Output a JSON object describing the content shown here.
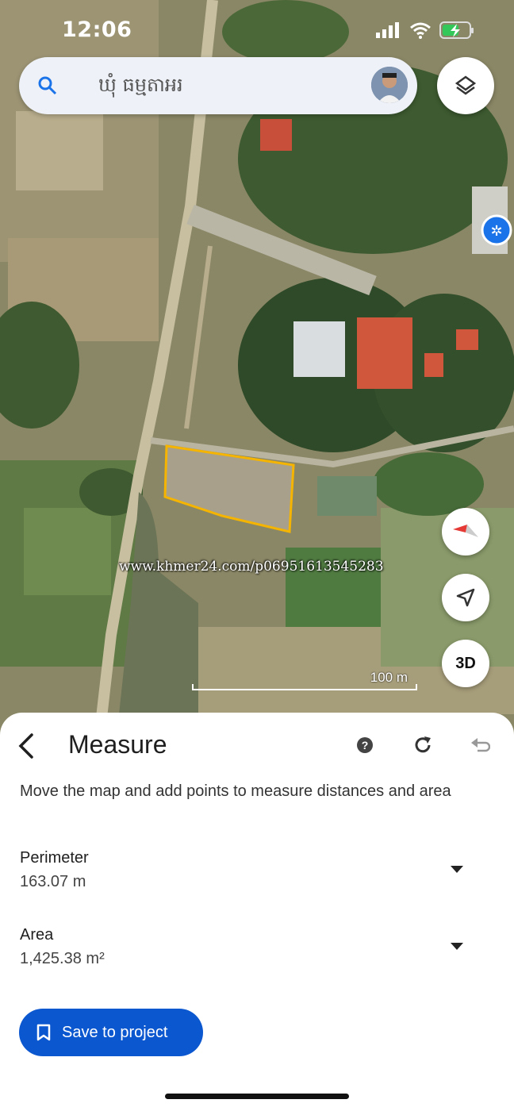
{
  "status_bar": {
    "time": "12:06"
  },
  "search": {
    "placeholder": "ឃុំ ធម្មតាអរ"
  },
  "map": {
    "watermark": "www.khmer24.com/p06951613545283",
    "scale_label": "100 m",
    "btn_3d": "3D"
  },
  "measure": {
    "title": "Measure",
    "description": "Move the map and add points to measure distances and area",
    "perimeter": {
      "label": "Perimeter",
      "value": "163.07 m"
    },
    "area": {
      "label": "Area",
      "value": "1,425.38 m²"
    },
    "save_label": "Save to project"
  },
  "colors": {
    "accent": "#0b57d0",
    "polygon": "#f5b400"
  },
  "icons": [
    "search-icon",
    "layers-icon",
    "compass-icon",
    "navigation-icon",
    "back-arrow-icon",
    "help-icon",
    "refresh-icon",
    "undo-icon",
    "bookmark-icon",
    "wifi-icon",
    "battery-icon",
    "cellular-icon"
  ]
}
